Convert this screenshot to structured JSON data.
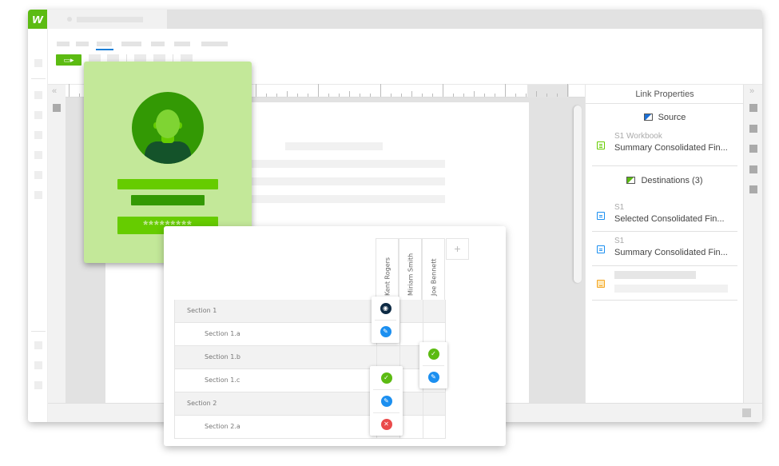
{
  "app": {
    "logo_text": "w",
    "brand_color": "#5cbb12"
  },
  "toolbar": {
    "present_icon": "▭▸"
  },
  "nav": {
    "collapse_left": "«",
    "collapse_right": "»"
  },
  "link_properties": {
    "title": "Link Properties",
    "source": {
      "header": "Source",
      "header_icon_color": "#1b6fd6",
      "item": {
        "sub": "S1 Workbook",
        "main": "Summary Consolidated Fin...",
        "icon": "spreadsheet-icon",
        "icon_color": "#66cc00"
      }
    },
    "destinations": {
      "header": "Destinations (3)",
      "header_icon_color": "#5cbb12",
      "items": [
        {
          "sub": "S1",
          "main": "Selected Consolidated Fin...",
          "icon": "document-icon",
          "icon_color": "#1b8ff0"
        },
        {
          "sub": "S1",
          "main": "Summary Consolidated Fin...",
          "icon": "document-icon",
          "icon_color": "#1b8ff0"
        },
        {
          "sub": "",
          "main": "",
          "icon": "presentation-icon",
          "icon_color": "#f5a623",
          "placeholder": true
        }
      ]
    }
  },
  "login_card": {
    "password_mask": "*********",
    "bg_color": "#c3e899"
  },
  "permissions": {
    "columns": [
      "Kent Rogers",
      "Miriam Smith",
      "Joe Bennett"
    ],
    "add_column_label": "+",
    "rows": [
      {
        "label": "Section 1",
        "level": 0
      },
      {
        "label": "Section 1.a",
        "level": 1
      },
      {
        "label": "Section 1.b",
        "level": 1
      },
      {
        "label": "Section 1.c",
        "level": 1
      },
      {
        "label": "Section 2",
        "level": 0
      },
      {
        "label": "Section 2.a",
        "level": 1
      }
    ],
    "cells": {
      "kent_rogers": {
        "section_1": "view",
        "section_1_a": "edit",
        "section_1_c": "approve",
        "section_2": "edit",
        "section_2_a": "deny"
      },
      "joe_bennett": {
        "section_1_b": "approve",
        "section_1_c": "edit"
      }
    },
    "icon_glyphs": {
      "view": "◉",
      "edit": "✎",
      "approve": "✓",
      "deny": "✕"
    },
    "icon_colors": {
      "view": "#0d2a44",
      "edit": "#1b8ff0",
      "approve": "#5cbb12",
      "deny": "#ea4b4b"
    }
  }
}
